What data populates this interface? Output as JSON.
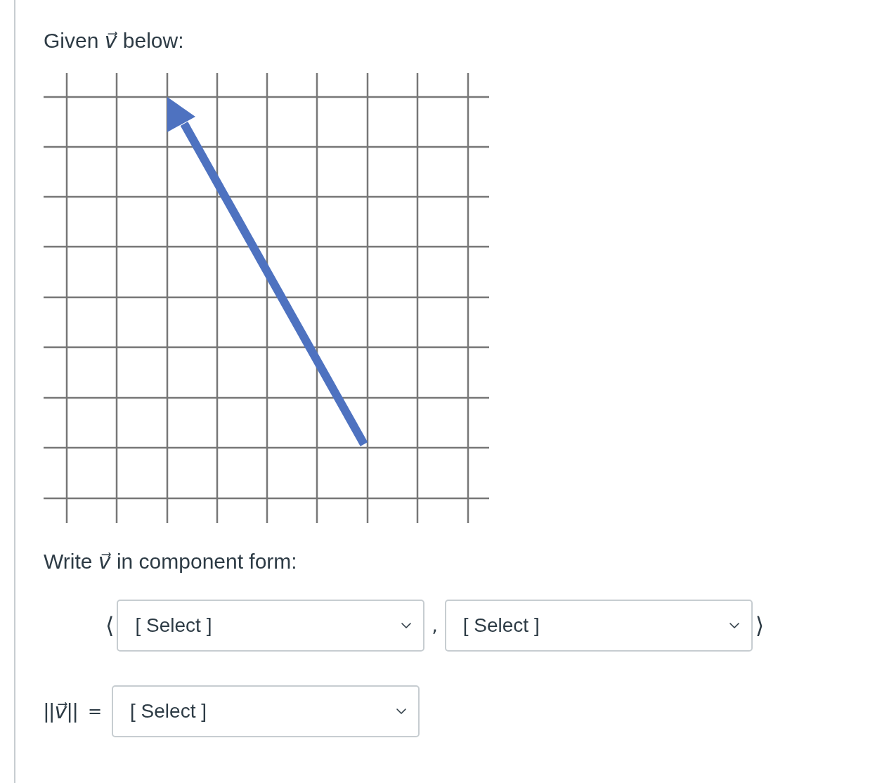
{
  "prompt": "Given *v⃗* below:",
  "question": "Write *v⃗* in component form:",
  "component_form": {
    "open_bracket": "⟨",
    "selects": [
      {
        "value": "[ Select ]"
      },
      {
        "value": "[ Select ]"
      }
    ],
    "separator": ",",
    "close_bracket": "⟩"
  },
  "magnitude": {
    "label": "||*v⃗*||",
    "equals": "=",
    "select": {
      "value": "[ Select ]"
    }
  }
}
